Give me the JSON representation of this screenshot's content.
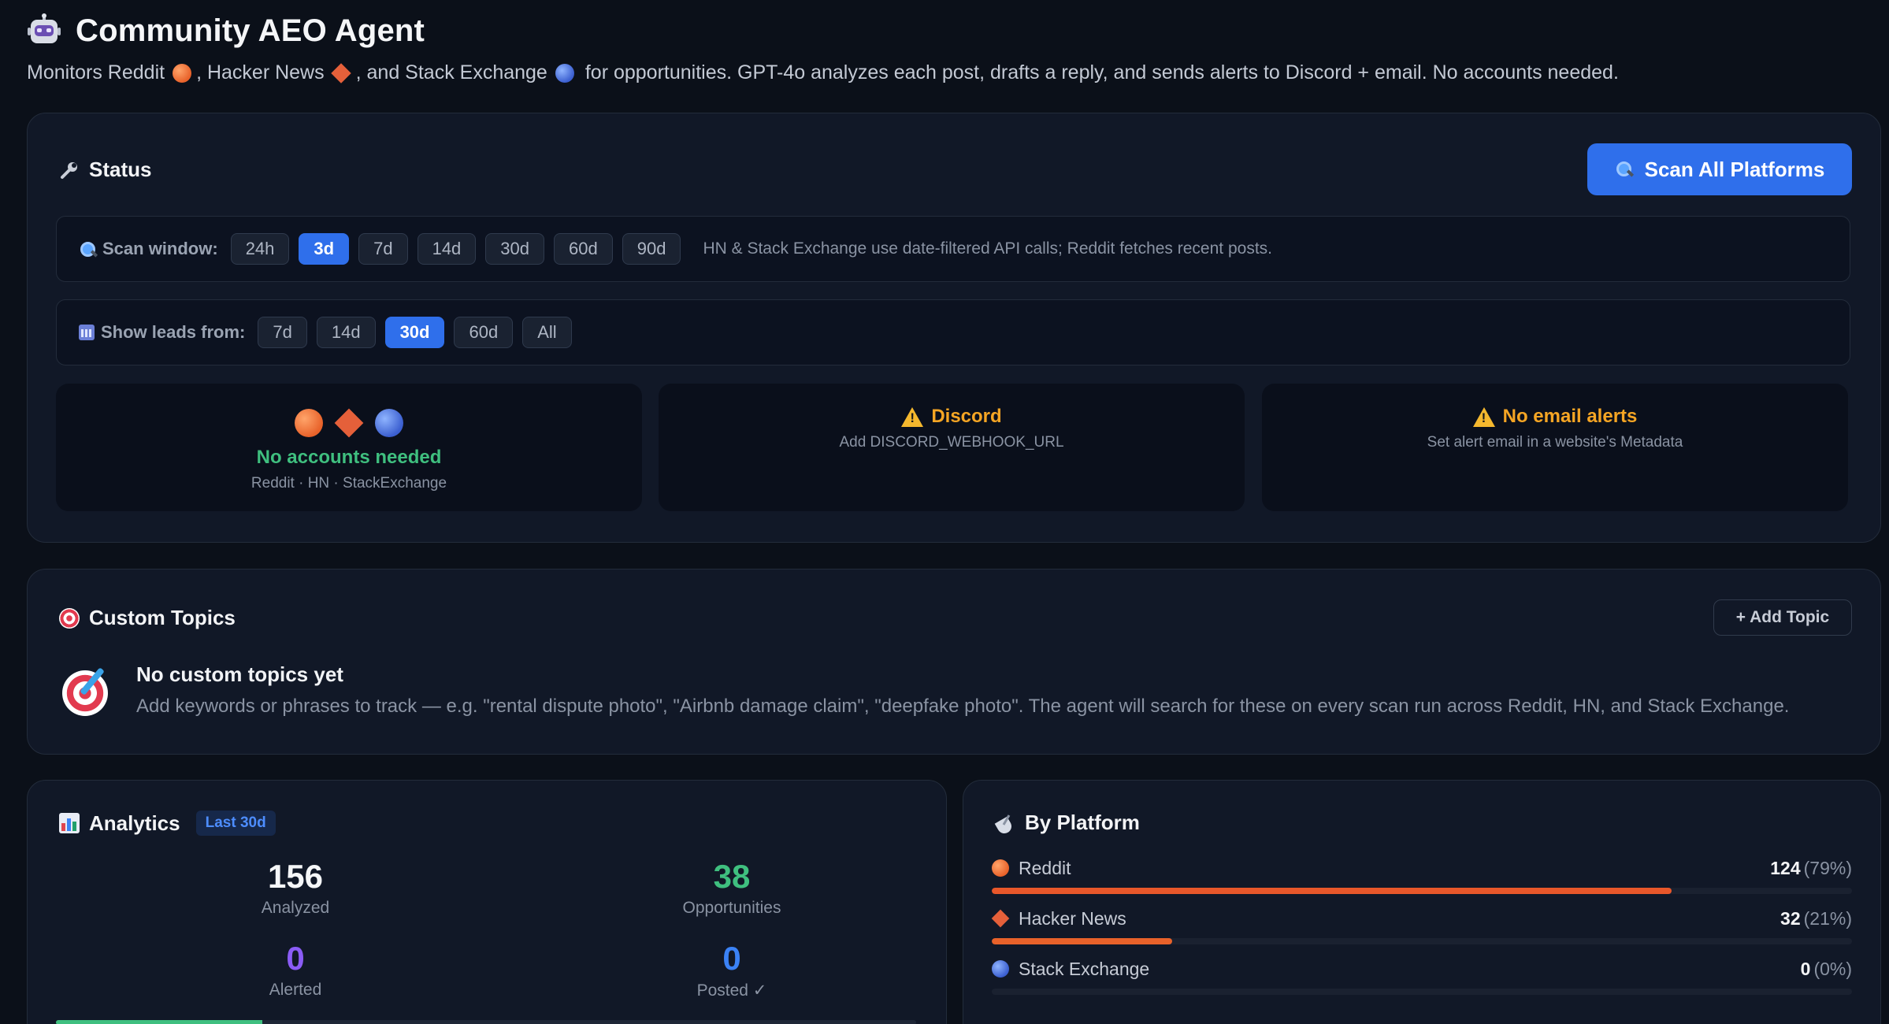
{
  "app": {
    "title": "Community AEO Agent",
    "subtitle_parts": {
      "a": "Monitors Reddit",
      "b": ", Hacker News",
      "c": ", and Stack Exchange",
      "d": "for opportunities. GPT-4o analyzes each post, drafts a reply, and sends alerts to Discord + email. No accounts needed."
    },
    "icon": "robot-icon"
  },
  "status": {
    "title": "Status",
    "icon": "wrench-icon",
    "scan_button": "Scan All Platforms",
    "scan_window": {
      "label": "Scan window:",
      "options": [
        "24h",
        "3d",
        "7d",
        "14d",
        "30d",
        "60d",
        "90d"
      ],
      "selected": "3d",
      "note": "HN & Stack Exchange use date-filtered API calls; Reddit fetches recent posts."
    },
    "leads_from": {
      "label": "Show leads from:",
      "options": [
        "7d",
        "14d",
        "30d",
        "60d",
        "All"
      ],
      "selected": "30d"
    },
    "boxes": {
      "accounts": {
        "title": "No accounts needed",
        "sub": "Reddit · HN · StackExchange"
      },
      "discord": {
        "title": "Discord",
        "sub": "Add DISCORD_WEBHOOK_URL"
      },
      "email": {
        "title": "No email alerts",
        "sub": "Set alert email in a website's Metadata"
      }
    }
  },
  "topics": {
    "title": "Custom Topics",
    "icon": "target-icon",
    "add_button": "+ Add Topic",
    "empty_title": "No custom topics yet",
    "empty_desc": "Add keywords or phrases to track — e.g. \"rental dispute photo\", \"Airbnb damage claim\", \"deepfake photo\". The agent will search for these on every scan run across Reddit, HN, and Stack Exchange."
  },
  "analytics": {
    "title": "Analytics",
    "range": "Last 30d",
    "stats": {
      "analyzed": {
        "value": "156",
        "label": "Analyzed"
      },
      "opportunities": {
        "value": "38",
        "label": "Opportunities"
      },
      "alerted": {
        "value": "0",
        "label": "Alerted"
      },
      "posted": {
        "value": "0",
        "label": "Posted ✓"
      }
    },
    "progress_fraction": 0.24
  },
  "platforms": {
    "title": "By Platform",
    "items": [
      {
        "name": "Reddit",
        "count": "124",
        "pct": "(79%)",
        "fraction": 0.79,
        "color": "#e8572a"
      },
      {
        "name": "Hacker News",
        "count": "32",
        "pct": "(21%)",
        "fraction": 0.21,
        "color": "#e8622a"
      },
      {
        "name": "Stack Exchange",
        "count": "0",
        "pct": "(0%)",
        "fraction": 0,
        "color": "#4f7be0"
      }
    ]
  },
  "colors": {
    "accent": "#2f6feb",
    "success": "#3fbf7f",
    "warning": "#f5a524",
    "background": "#0b1019"
  }
}
